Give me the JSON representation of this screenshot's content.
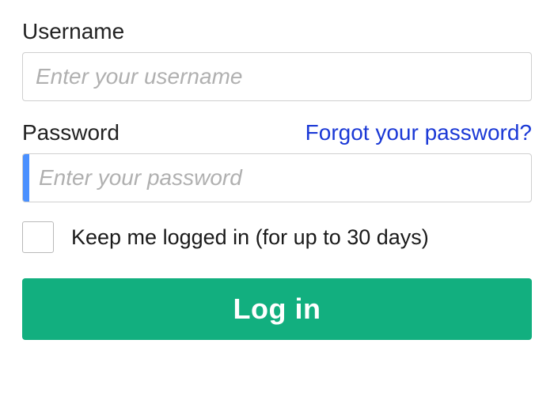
{
  "username": {
    "label": "Username",
    "placeholder": "Enter your username",
    "value": ""
  },
  "password": {
    "label": "Password",
    "placeholder": "Enter your password",
    "value": "",
    "forgot_link": "Forgot your password?"
  },
  "remember": {
    "label": "Keep me logged in (for up to 30 days)",
    "checked": false
  },
  "submit": {
    "label": "Log in"
  }
}
